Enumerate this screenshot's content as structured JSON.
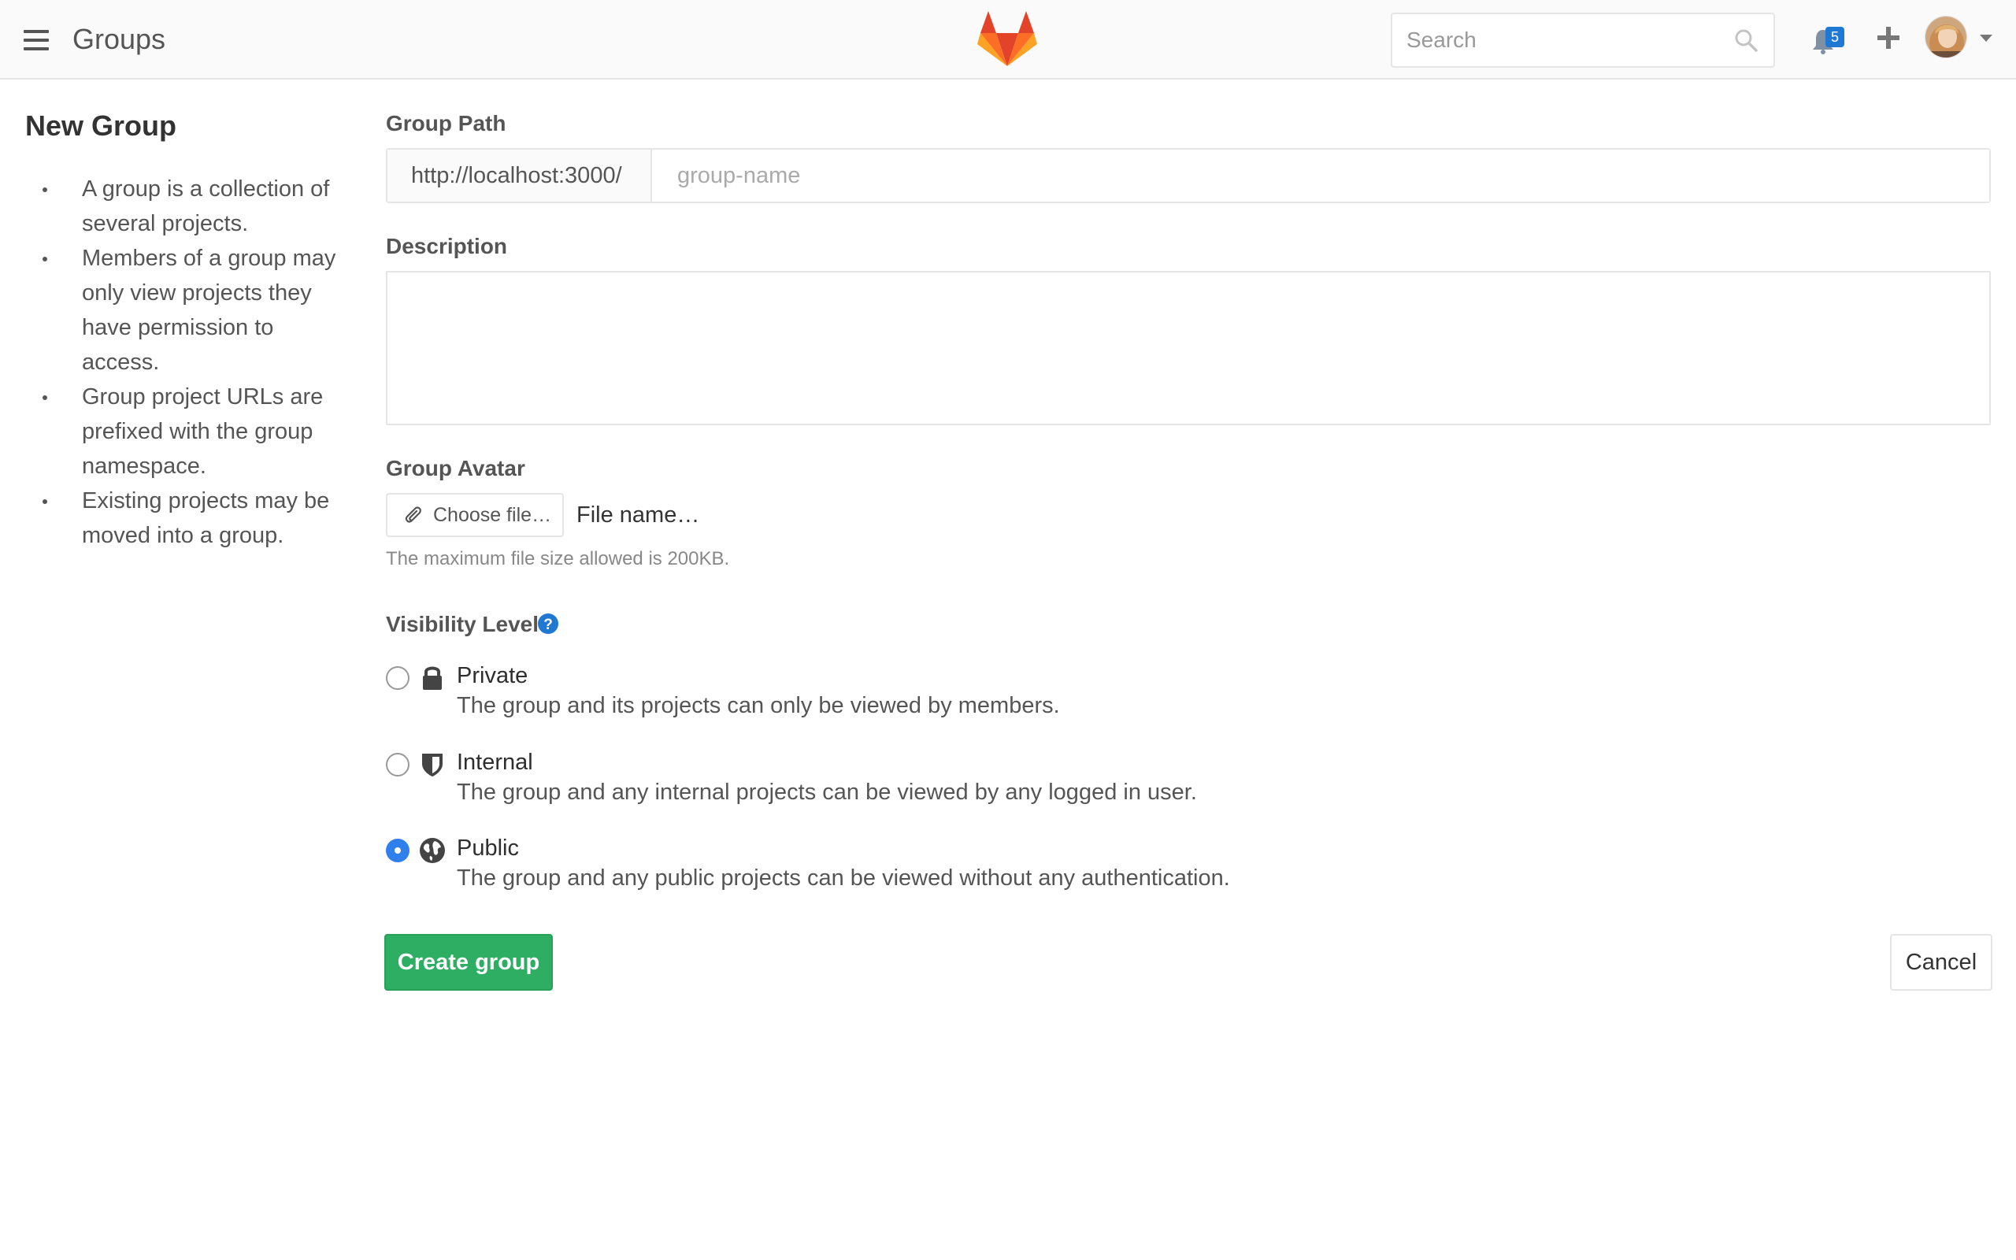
{
  "header": {
    "title": "Groups",
    "search_placeholder": "Search",
    "notification_count": "5",
    "brand_colors": {
      "logo_orange": "#fc6d26",
      "logo_red": "#e24329",
      "logo_light": "#fca326"
    }
  },
  "sidebar": {
    "title": "New Group",
    "items": [
      {
        "lines": [
          "A group is a collection of",
          "several projects."
        ]
      },
      {
        "lines": [
          "Members of a group may",
          "only view projects they",
          "have permission to",
          "access."
        ]
      },
      {
        "lines": [
          "Group project URLs are",
          "prefixed with the group",
          "namespace."
        ]
      },
      {
        "lines": [
          "Existing projects may be",
          "moved into a group."
        ]
      }
    ]
  },
  "form": {
    "group_path_label": "Group Path",
    "path_prefix": "http://localhost:3000/",
    "path_placeholder": "group-name",
    "path_value": "",
    "description_label": "Description",
    "description_value": "",
    "avatar_label": "Group Avatar",
    "choose_file_label": "Choose file…",
    "file_name": "File name…",
    "file_help": "The maximum file size allowed is 200KB.",
    "visibility_label": "Visibility Level",
    "visibility_options": [
      {
        "title": "Private",
        "description": "The group and its projects can only be viewed by members.",
        "icon": "lock-icon",
        "selected": false
      },
      {
        "title": "Internal",
        "description": "The group and any internal projects can be viewed by any logged in user.",
        "icon": "shield-icon",
        "selected": false
      },
      {
        "title": "Public",
        "description": "The group and any public projects can be viewed without any authentication.",
        "icon": "globe-icon",
        "selected": true
      }
    ],
    "create_button": "Create group",
    "cancel_button": "Cancel",
    "accent_color": "#2eae62",
    "radio_selected_color": "#2f80ed"
  }
}
